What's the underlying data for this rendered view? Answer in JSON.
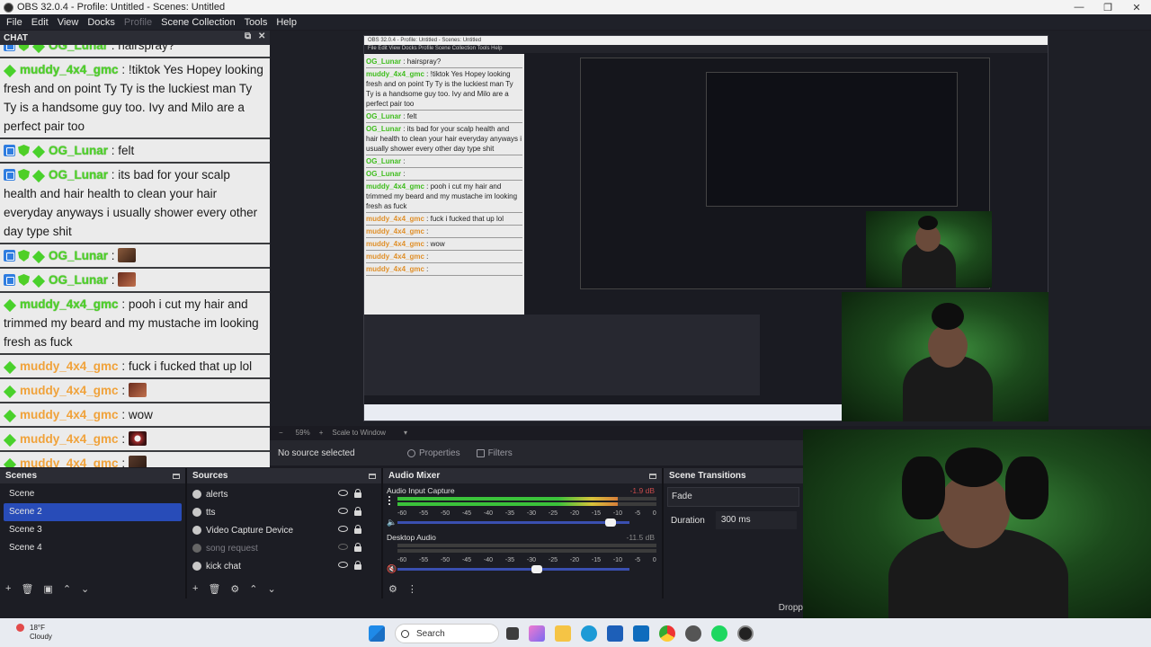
{
  "window": {
    "title": "OBS 32.0.4 - Profile: Untitled - Scenes: Untitled",
    "controls": [
      "—",
      "❐",
      "✕"
    ]
  },
  "menu": [
    "File",
    "Edit",
    "View",
    "Docks",
    "Profile",
    "Scene Collection",
    "Tools",
    "Help"
  ],
  "chat": {
    "title": "CHAT",
    "messages": [
      {
        "user": "OG_Lunar",
        "color": "green",
        "text": " : hairspray?",
        "badges": [
          "mod",
          "shield",
          "gem"
        ]
      },
      {
        "user": "muddy_4x4_gmc",
        "color": "green",
        "text": " : !tiktok Yes Hopey looking fresh and on point Ty Ty is the luckiest man Ty Ty is a handsome guy too. Ivy and Milo are a perfect pair too",
        "badges": [
          "gem"
        ]
      },
      {
        "user": "OG_Lunar",
        "color": "green",
        "text": " : felt",
        "badges": [
          "mod",
          "shield",
          "gem"
        ]
      },
      {
        "user": "OG_Lunar",
        "color": "green",
        "text": " : its bad for your scalp health and hair health to clean your hair everyday anyways i usually shower every other day type shit",
        "badges": [
          "mod",
          "shield",
          "gem"
        ]
      },
      {
        "user": "OG_Lunar",
        "color": "green",
        "text": " : ",
        "badges": [
          "mod",
          "shield",
          "gem"
        ],
        "emote": "e1"
      },
      {
        "user": "OG_Lunar",
        "color": "green",
        "text": " : ",
        "badges": [
          "mod",
          "shield",
          "gem"
        ],
        "emote": "e2"
      },
      {
        "user": "muddy_4x4_gmc",
        "color": "green",
        "text": " : pooh i cut my hair and trimmed my beard and my mustache im looking fresh as fuck",
        "badges": [
          "gem"
        ]
      },
      {
        "user": "muddy_4x4_gmc",
        "color": "orange",
        "text": " : fuck i fucked that up lol",
        "badges": [
          "gem"
        ]
      },
      {
        "user": "muddy_4x4_gmc",
        "color": "orange",
        "text": " : ",
        "badges": [
          "gem"
        ],
        "emote": "e2"
      },
      {
        "user": "muddy_4x4_gmc",
        "color": "orange",
        "text": " : wow",
        "badges": [
          "gem"
        ]
      },
      {
        "user": "muddy_4x4_gmc",
        "color": "orange",
        "text": " : ",
        "badges": [
          "gem"
        ],
        "emote": "e3"
      },
      {
        "user": "muddy_4x4_gmc",
        "color": "orange",
        "text": " : ",
        "badges": [
          "gem"
        ],
        "emote": "e4"
      }
    ]
  },
  "preview": {
    "zoom": "59%",
    "scale_mode": "Scale to Window",
    "no_source": "No source selected",
    "properties": "Properties",
    "filters": "Filters"
  },
  "scenes": {
    "title": "Scenes",
    "items": [
      "Scene",
      "Scene 2",
      "Scene 3",
      "Scene 4"
    ],
    "selected": 1
  },
  "sources": {
    "title": "Sources",
    "items": [
      {
        "name": "alerts",
        "visible": true
      },
      {
        "name": "tts",
        "visible": true
      },
      {
        "name": "Video Capture Device",
        "visible": true
      },
      {
        "name": "song request",
        "visible": false
      },
      {
        "name": "kick chat",
        "visible": true
      }
    ]
  },
  "mixer": {
    "title": "Audio Mixer",
    "channels": [
      {
        "name": "Audio Input Capture",
        "db": "-1.9 dB",
        "level": 0.85,
        "volume": 0.92
      },
      {
        "name": "Desktop Audio",
        "db": "-11.5 dB",
        "level": 0.0,
        "volume": 0.6
      }
    ],
    "ticks": [
      "-60",
      "-55",
      "-50",
      "-45",
      "-40",
      "-35",
      "-30",
      "-25",
      "-20",
      "-15",
      "-10",
      "-5",
      "0"
    ]
  },
  "transitions": {
    "title": "Scene Transitions",
    "type": "Fade",
    "duration_label": "Duration",
    "duration": "300 ms"
  },
  "status": {
    "drop": "Dropp"
  },
  "taskbar": {
    "temp": "18°F",
    "condition": "Cloudy",
    "search": "Search"
  },
  "colors": {
    "selected": "#284cb8",
    "chat_green": "#4fd12a",
    "chat_orange": "#f0a23a"
  }
}
